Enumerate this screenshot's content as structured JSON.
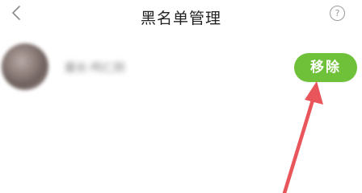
{
  "header": {
    "title": "黑名单管理",
    "help_label": "?"
  },
  "blacklist": {
    "items": [
      {
        "username": "最长·鸣仁则",
        "action_label": "移除"
      }
    ]
  },
  "colors": {
    "accent": "#6fc13a",
    "arrow": "#e8565c"
  },
  "icons": {
    "back": "chevron-left-icon",
    "help": "question-circle-icon",
    "annotation": "arrow-annotation"
  }
}
